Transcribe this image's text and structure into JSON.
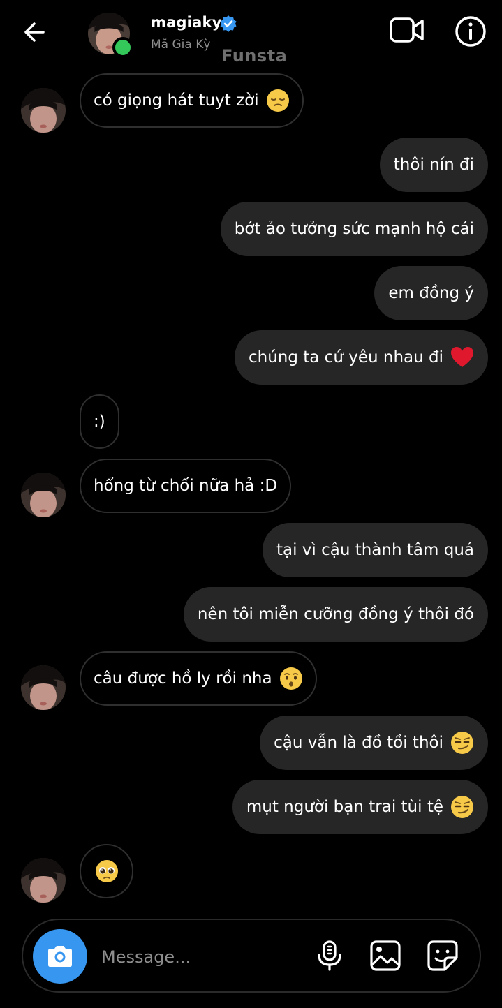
{
  "header": {
    "username": "magiaky",
    "full_name": "Mã Gia Kỳ",
    "watermark": "Funsta",
    "online_status_color": "#34c759",
    "verified_badge_color": "#3897f0",
    "icons": [
      "back-arrow-icon",
      "verified-badge-icon",
      "video-call-icon",
      "info-icon"
    ]
  },
  "messages": [
    {
      "from": "them",
      "text": "có giọng hát tuyt zời",
      "emoji": "pensive-face"
    },
    {
      "from": "me",
      "text": "thôi nín đi"
    },
    {
      "from": "me",
      "text": "bớt ảo tưởng sức mạnh hộ cái"
    },
    {
      "from": "me",
      "text": "em đồng ý"
    },
    {
      "from": "me",
      "text": "chúng ta cứ yêu nhau đi",
      "emoji": "red-heart"
    },
    {
      "from": "them",
      "text": ":)"
    },
    {
      "from": "them",
      "text": "hổng từ chối nữa hả :D"
    },
    {
      "from": "me",
      "text": "tại vì cậu thành tâm quá"
    },
    {
      "from": "me",
      "text": "nên tôi miễn cưỡng đồng ý thôi đó"
    },
    {
      "from": "them",
      "text": "câu được hồ ly rồi nha",
      "emoji": "kissing-face"
    },
    {
      "from": "me",
      "text": "cậu vẫn là đồ tồi thôi",
      "emoji": "smirking-face"
    },
    {
      "from": "me",
      "text": "mụt người bạn trai tùi tệ",
      "emoji": "smirking-face"
    },
    {
      "from": "them",
      "text": "",
      "emoji": "pleading-face"
    }
  ],
  "composer": {
    "placeholder": "Message...",
    "camera_button_color": "#3797f0",
    "icons": [
      "camera-icon",
      "microphone-icon",
      "gallery-icon",
      "sticker-icon"
    ]
  }
}
